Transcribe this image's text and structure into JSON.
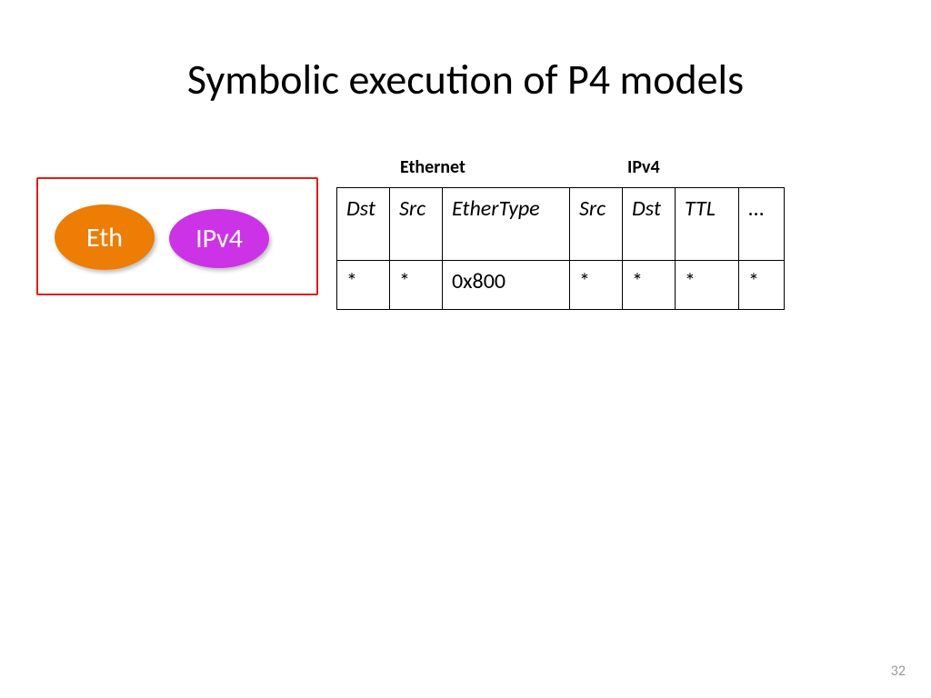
{
  "slide": {
    "title": "Symbolic execution of P4 models",
    "page_number": "32"
  },
  "packet": {
    "eth_label": "Eth",
    "ipv4_label": "IPv4"
  },
  "groups": {
    "ethernet": "Ethernet",
    "ipv4": "IPv4"
  },
  "table": {
    "headers": {
      "dst1": "Dst",
      "src1": "Src",
      "ethertype": "EtherType",
      "src2": "Src",
      "dst2": "Dst",
      "ttl": "TTL",
      "more": "..."
    },
    "row": {
      "dst1": "*",
      "src1": "*",
      "ethertype": "0x800",
      "src2": "*",
      "dst2": "*",
      "ttl": "*",
      "more": "*"
    }
  }
}
